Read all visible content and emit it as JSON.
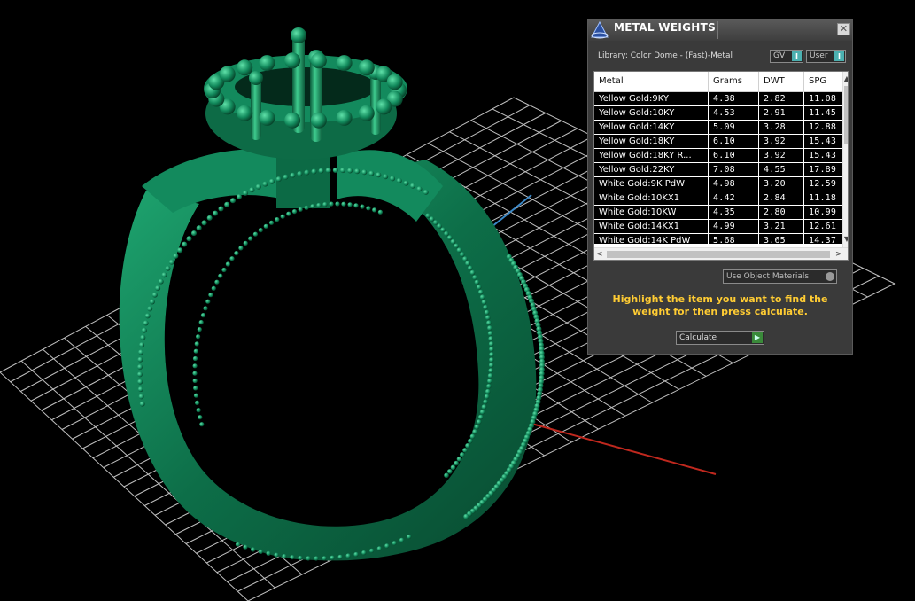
{
  "panel": {
    "title": "METAL WEIGHTS",
    "close_glyph": "✕",
    "library_label": "Library: Color Dome - (Fast)-Metal",
    "toggle_gv": "GV",
    "toggle_user": "User",
    "use_object_materials": "Use Object Materials",
    "hint": "Highlight the item you want to find the weight for then press calculate.",
    "calculate_label": "Calculate",
    "columns": [
      "Metal",
      "Grams",
      "DWT",
      "SPG"
    ],
    "rows": [
      [
        "Yellow Gold:9KY",
        "4.38",
        "2.82",
        "11.08"
      ],
      [
        "Yellow Gold:10KY",
        "4.53",
        "2.91",
        "11.45"
      ],
      [
        "Yellow Gold:14KY",
        "5.09",
        "3.28",
        "12.88"
      ],
      [
        "Yellow Gold:18KY",
        "6.10",
        "3.92",
        "15.43"
      ],
      [
        "Yellow Gold:18KY R...",
        "6.10",
        "3.92",
        "15.43"
      ],
      [
        "Yellow Gold:22KY",
        "7.08",
        "4.55",
        "17.89"
      ],
      [
        "White Gold:9K PdW",
        "4.98",
        "3.20",
        "12.59"
      ],
      [
        "White Gold:10KX1",
        "4.42",
        "2.84",
        "11.18"
      ],
      [
        "White Gold:10KW",
        "4.35",
        "2.80",
        "10.99"
      ],
      [
        "White Gold:14KX1",
        "4.99",
        "3.21",
        "12.61"
      ],
      [
        "White Gold:14K PdW",
        "5.68",
        "3.65",
        "14.37"
      ]
    ]
  },
  "viewport": {
    "background": "#000000",
    "grid_color": "#bfbfbf",
    "ring_color": "#0f7a52",
    "axis_x_color": "#c0281e",
    "axis_y_color": "#3a88c8"
  }
}
